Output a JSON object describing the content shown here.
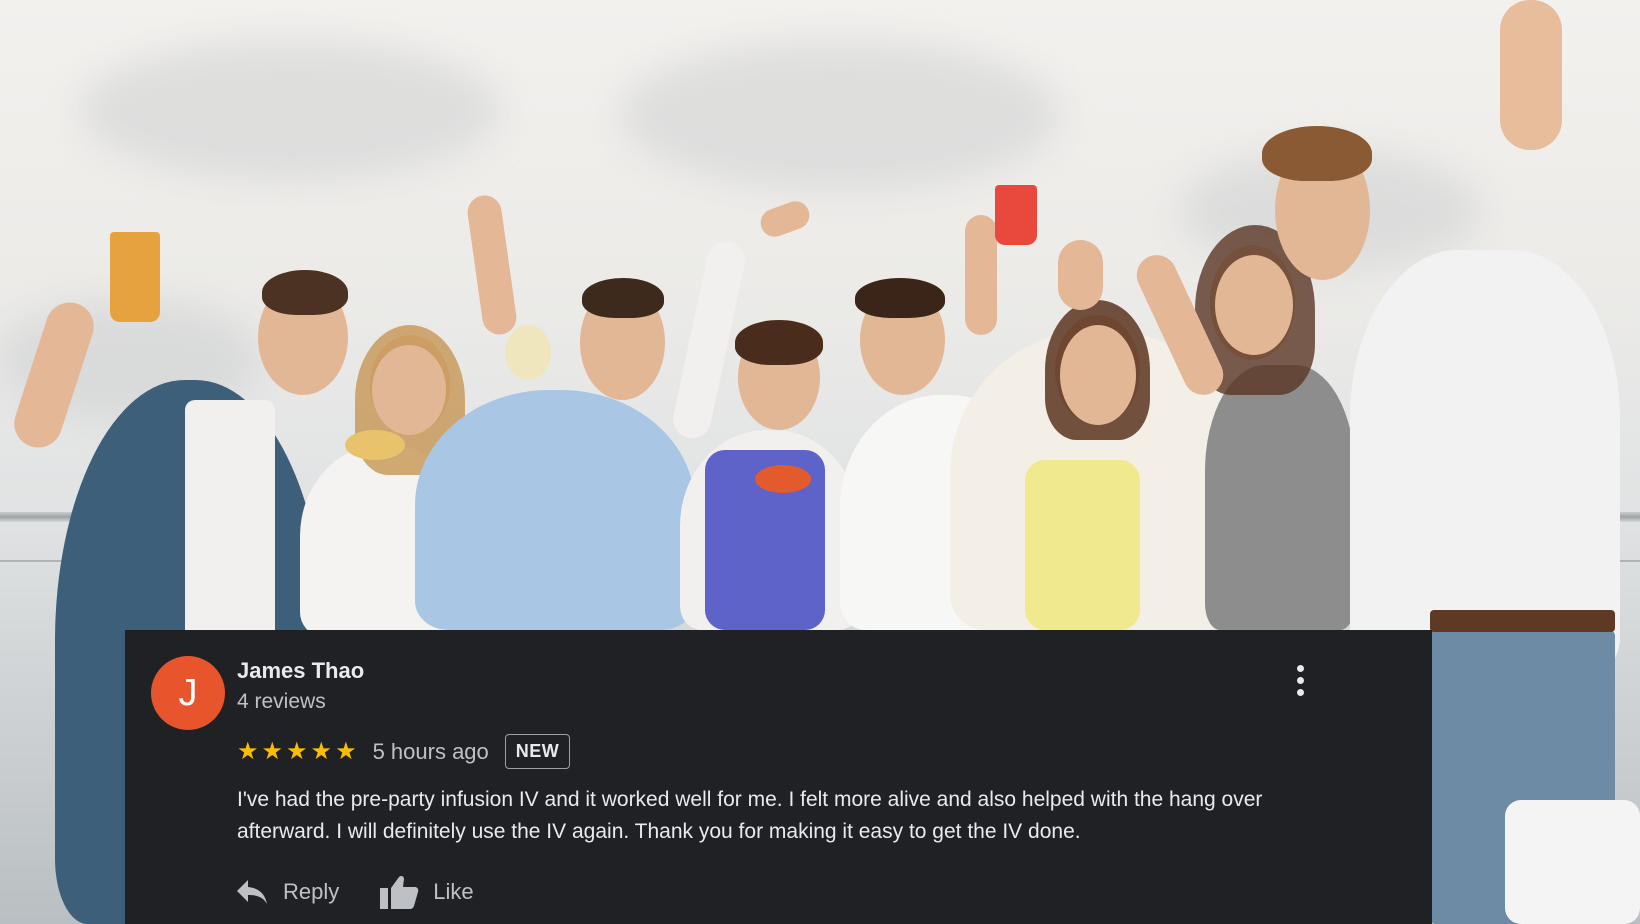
{
  "review": {
    "author_initial": "J",
    "author_name": "James Thao",
    "author_reviews": "4 reviews",
    "rating": 5,
    "rating_max": 5,
    "stars": [
      "★",
      "★",
      "★",
      "★",
      "★"
    ],
    "time": "5 hours ago",
    "badge": "NEW",
    "text": "I've had the pre-party infusion IV and it worked well for me. I felt more alive and also helped with the hang over afterward. I will definitely use the IV again. Thank you for making it easy to get the IV done.",
    "reply_label": "Reply",
    "like_label": "Like",
    "icons": [
      "more-vert-icon",
      "reply-icon",
      "thumbs-up-icon"
    ]
  },
  "colors": {
    "card_background": "#202124",
    "avatar_background": "#e8542b",
    "star": "#fbbc04",
    "primary_text": "#e8eaed",
    "secondary_text": "#bdc1c6"
  }
}
